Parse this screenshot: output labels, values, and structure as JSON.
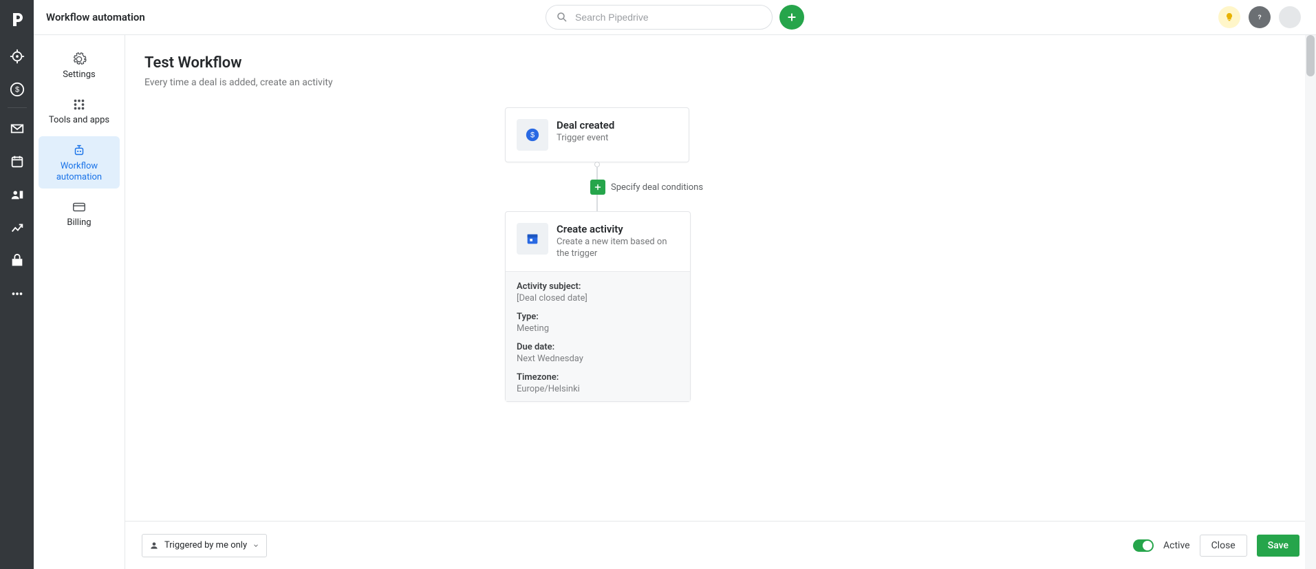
{
  "topbar": {
    "title": "Workflow automation",
    "search_placeholder": "Search Pipedrive"
  },
  "subnav": {
    "items": [
      {
        "key": "settings",
        "label": "Settings"
      },
      {
        "key": "tools",
        "label": "Tools and apps"
      },
      {
        "key": "workflow",
        "label": "Workflow automation"
      },
      {
        "key": "billing",
        "label": "Billing"
      }
    ]
  },
  "workflow": {
    "title": "Test Workflow",
    "description": "Every time a deal is added, create an activity"
  },
  "nodes": {
    "trigger": {
      "title": "Deal created",
      "sub": "Trigger event"
    },
    "conditions_label": "Specify deal conditions",
    "action": {
      "title": "Create activity",
      "sub": "Create a new item based on the trigger",
      "fields": [
        {
          "label": "Activity subject:",
          "value": "[Deal closed date]"
        },
        {
          "label": "Type:",
          "value": "Meeting"
        },
        {
          "label": "Due date:",
          "value": "Next Wednesday"
        },
        {
          "label": "Timezone:",
          "value": "Europe/Helsinki"
        }
      ]
    }
  },
  "footer": {
    "triggered_label": "Triggered by me only",
    "active_label": "Active",
    "close_label": "Close",
    "save_label": "Save"
  }
}
